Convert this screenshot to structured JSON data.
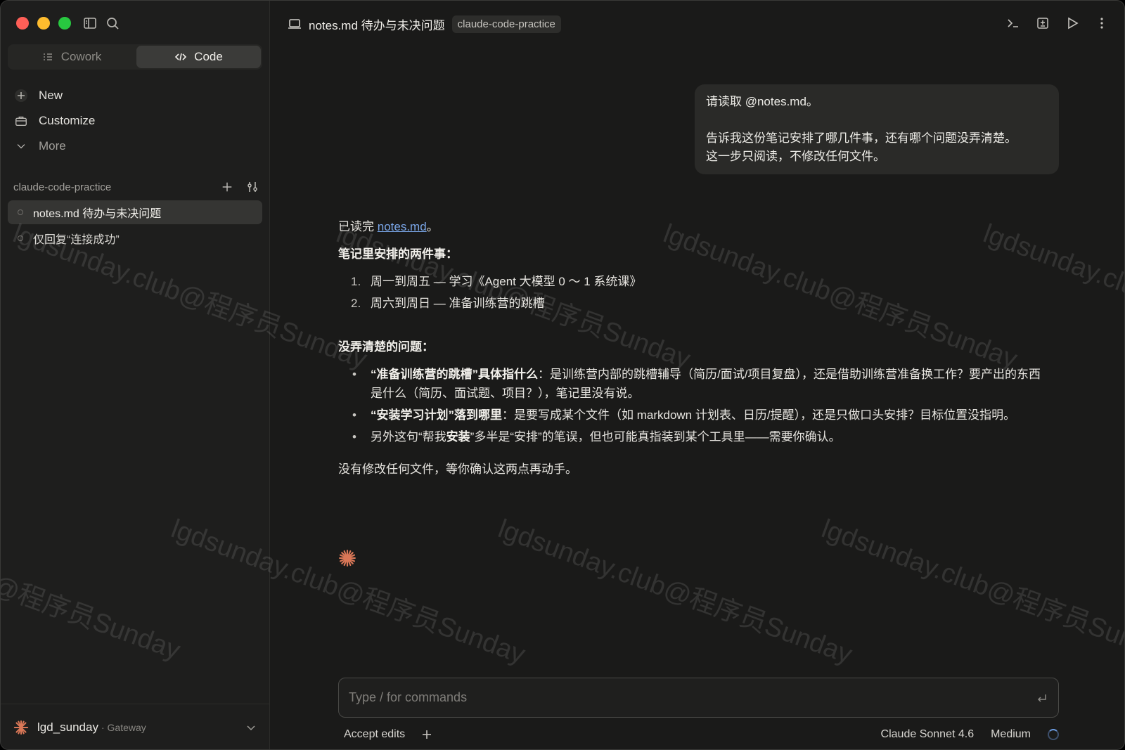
{
  "window": {
    "title": "notes.md 待办与未决问题",
    "project_chip": "claude-code-practice"
  },
  "mode_switch": {
    "cowork": "Cowork",
    "code": "Code",
    "active": "Code"
  },
  "nav": {
    "new": "New",
    "customize": "Customize",
    "more": "More"
  },
  "project": {
    "name": "claude-code-practice"
  },
  "sessions": [
    {
      "label": "notes.md 待办与未决问题",
      "active": true
    },
    {
      "label": "仅回复“连接成功”",
      "active": false
    }
  ],
  "account": {
    "name": "lgd_sunday",
    "tag": "· Gateway"
  },
  "user_message": {
    "line1": "请读取 @notes.md。",
    "line2": "告诉我这份笔记安排了哪几件事，还有哪个问题没弄清楚。",
    "line3": "这一步只阅读，不修改任何文件。"
  },
  "response": {
    "read_prefix": "已读完 ",
    "read_link": "notes.md",
    "read_suffix": "。",
    "tasks_heading": "笔记里安排的两件事：",
    "tasks": [
      {
        "num": "1.",
        "text": "周一到周五 — 学习《Agent 大模型 0 ～ 1 系统课》"
      },
      {
        "num": "2.",
        "text": "周六到周日 — 准备训练营的跳槽"
      }
    ],
    "issues_heading": "没弄清楚的问题：",
    "issues": [
      {
        "bold": "“准备训练营的跳槽”具体指什么",
        "text": "：是训练营内部的跳槽辅导（简历/面试/项目复盘），还是借助训练营准备换工作？要产出的东西是什么（简历、面试题、项目？），笔记里没有说。"
      },
      {
        "bold": "“安装学习计划”落到哪里",
        "text": "：是要写成某个文件（如 markdown 计划表、日历/提醒），还是只做口头安排？目标位置没指明。"
      },
      {
        "pre": "另外这句“帮我",
        "bold": "安装",
        "text": "”多半是“安排”的笔误，但也可能真指装到某个工具里——需要你确认。"
      }
    ],
    "final": "没有修改任何文件，等你确认这两点再动手。"
  },
  "composer": {
    "placeholder": "Type / for commands",
    "value": ""
  },
  "footer": {
    "accept_edits": "Accept edits",
    "model": "Claude Sonnet 4.6",
    "effort": "Medium"
  },
  "watermark": {
    "text1": "lgdsunday.club@程序员Sunday",
    "text2": "@程序员Sunday"
  },
  "colors": {
    "accent": "#d97757",
    "link": "#7aa6e8",
    "background": "#1a1a19"
  }
}
